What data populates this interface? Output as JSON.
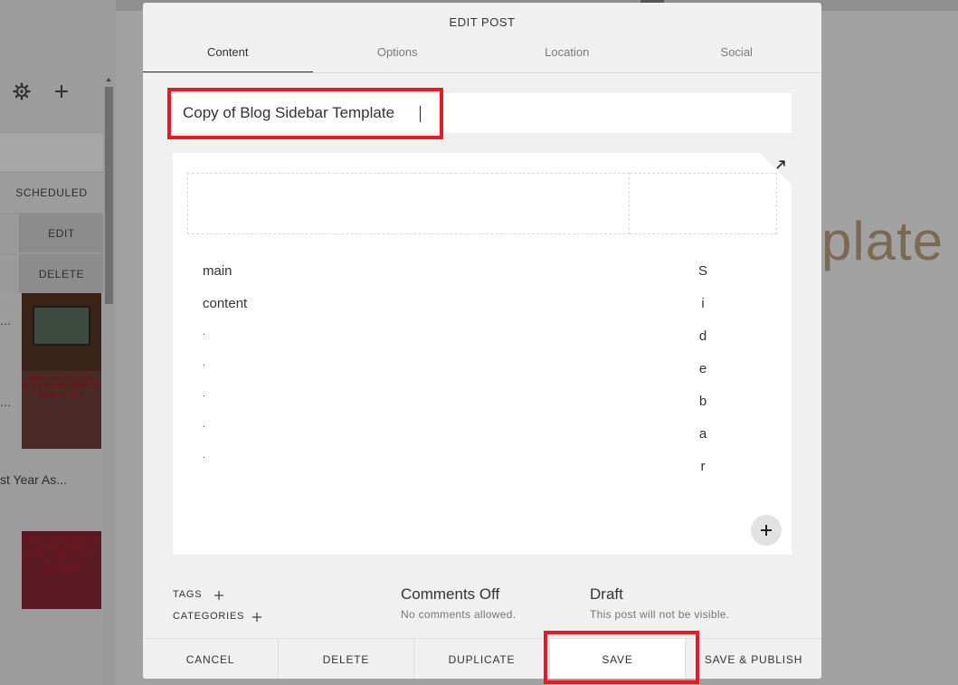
{
  "modal": {
    "title": "EDIT POST",
    "tabs": [
      {
        "label": "Content",
        "active": true
      },
      {
        "label": "Options",
        "active": false
      },
      {
        "label": "Location",
        "active": false
      },
      {
        "label": "Social",
        "active": false
      }
    ],
    "post_title": "Copy of Blog Sidebar Template",
    "editor": {
      "main_lines": [
        "main",
        "content",
        ".",
        ".",
        ".",
        ".",
        "."
      ],
      "sidebar_chars": [
        "S",
        "i",
        "d",
        "e",
        "b",
        "a",
        "r"
      ]
    },
    "meta": {
      "tags_label": "TAGS",
      "categories_label": "CATEGORIES",
      "comments_title": "Comments Off",
      "comments_sub": "No comments allowed.",
      "status_title": "Draft",
      "status_sub": "This post will not be visible."
    },
    "footer": {
      "cancel": "CANCEL",
      "delete": "DELETE",
      "duplicate": "DUPLICATE",
      "save": "SAVE",
      "save_publish": "SAVE & PUBLISH"
    }
  },
  "background": {
    "row_scheduled": "SCHEDULED",
    "row_edit": "EDIT",
    "row_delete": "DELETE",
    "thumb2_text": "HOW TO OPTIMIZE BLOG POSTS BEFORE PUBLISHING",
    "thumb3_text": "NEED A WEBSITE FOR YOUR BUSINESS THAT LOOKS GOOD & ACTUALLY CONVERTS?",
    "post_item_text": "st Year As...",
    "big_title": "plate"
  },
  "colors": {
    "highlight": "#e31c23",
    "modal_bg": "#f0f0f0",
    "overlay": "#8f8f8f"
  },
  "icons": [
    "gear-icon",
    "plus-icon",
    "expand-icon",
    "add-block-icon"
  ]
}
